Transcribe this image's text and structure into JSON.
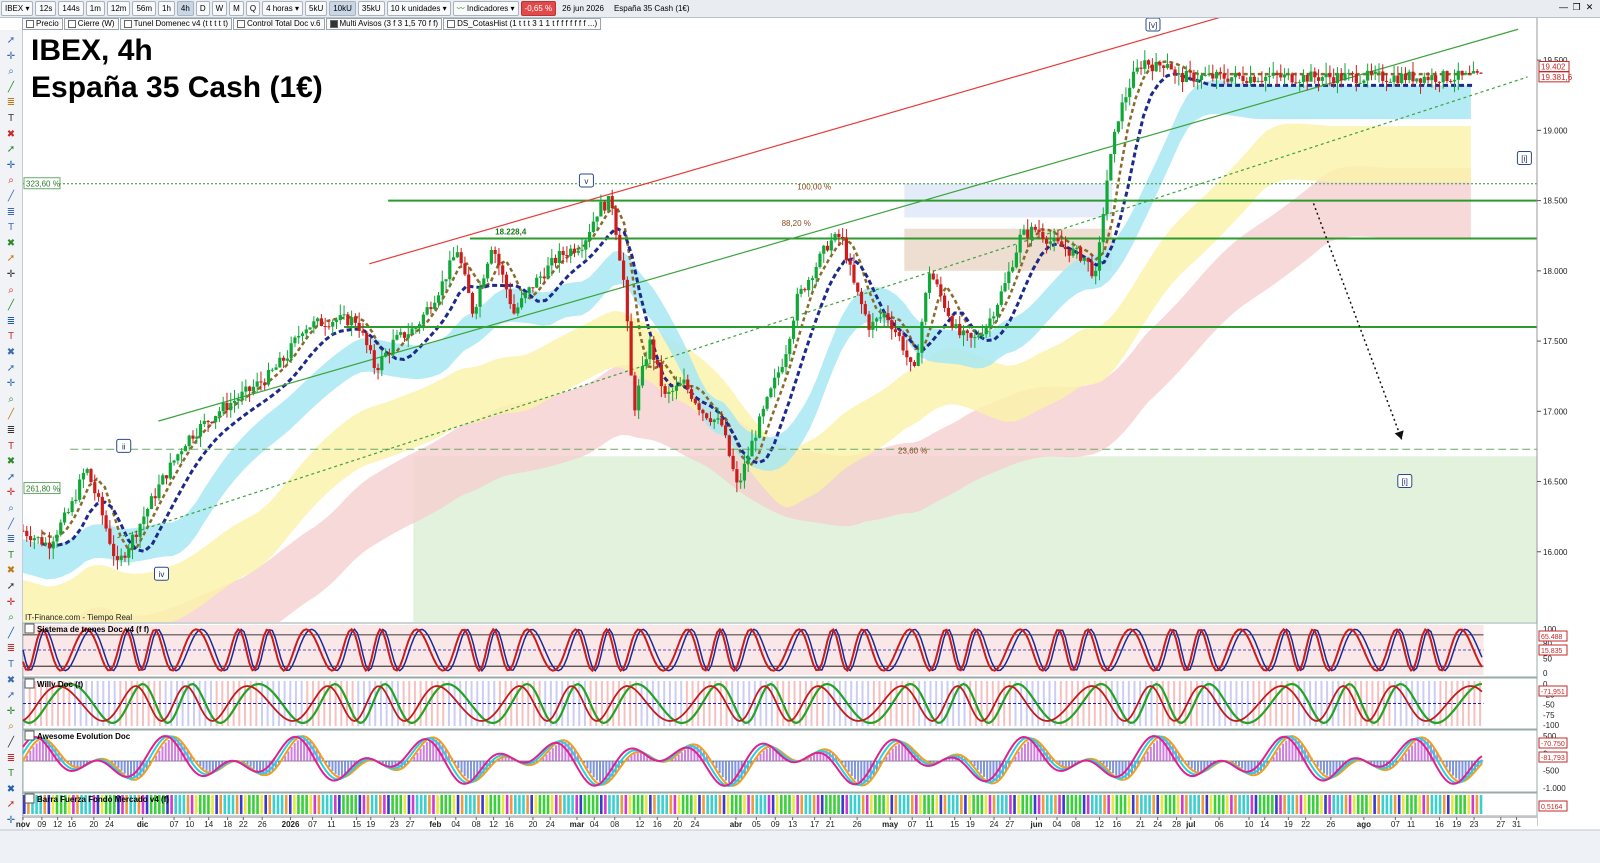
{
  "toolbar": {
    "symbol": "IBEX",
    "intervals": [
      "12s",
      "144s",
      "1m",
      "12m",
      "56m",
      "1h",
      "4h",
      "D",
      "W",
      "M",
      "Q"
    ],
    "active_interval": "4h",
    "period_label": "4 horas",
    "volume_buttons": [
      "5kU",
      "10kU",
      "35kU"
    ],
    "units_label": "10 k unidades",
    "indicators_label": "Indicadores",
    "change": "-0,65 %",
    "date": "26 jun 2026",
    "instrument": "España 35 Cash (1€)"
  },
  "ribbon": [
    {
      "label": "Precio",
      "checked": false
    },
    {
      "label": "Cierre (W)",
      "checked": false
    },
    {
      "label": "Tunel Domenec v4 (t t t t t)",
      "checked": false
    },
    {
      "label": "Control Total Doc v.6",
      "checked": false
    },
    {
      "label": "Multi Avisos (3 f 3 1,5 70 f f)",
      "checked": true
    },
    {
      "label": "DS_CotasHist (1 t t t 3 1 1 t f f f f f f f ...)",
      "checked": false
    }
  ],
  "title": {
    "line1": "IBEX, 4h",
    "line2": "España 35 Cash (1€)"
  },
  "source_label": "IT-Finance.com - Tiempo Real",
  "icons": [
    "pointer-icon",
    "crosshair-icon",
    "zoom-icon",
    "line-tool-icon",
    "fibonacci-icon",
    "text-tool-icon",
    "trash-icon"
  ],
  "colors": {
    "candle_up": "#11a83a",
    "candle_down": "#cc1c1c",
    "red_channel": "#e83a3a",
    "green_channel": "#3ca33c",
    "horizontal_levels": "#2c9a2c",
    "ma_fast": "#1d2a8a",
    "ma_slow": "#8a6a2a",
    "band_cyan": "#a8e8f2",
    "band_yellow": "#fbf3a8",
    "band_red": "#f6cccc",
    "zone_green": "#dff1d9",
    "price_tag": "#c62828"
  },
  "chart_data": {
    "type": "candlestick",
    "instrument": "IBEX",
    "timeframe": "4h",
    "y_axis": {
      "min": 15500,
      "max": 19800,
      "ticks": [
        16000,
        16500,
        17000,
        17500,
        18000,
        18500,
        19000,
        19500
      ],
      "tick_labels": [
        "16.000",
        "16.500",
        "17.000",
        "17.500",
        "18.000",
        "18.500",
        "19.000",
        "19.500"
      ]
    },
    "x_axis": {
      "labels": [
        {
          "t": 0,
          "label": "nov"
        },
        {
          "t": 0.6,
          "label": "09"
        },
        {
          "t": 1.1,
          "label": "12"
        },
        {
          "t": 1.55,
          "label": "16"
        },
        {
          "t": 2.25,
          "label": "20"
        },
        {
          "t": 2.75,
          "label": "24"
        },
        {
          "t": 3.8,
          "label": "dic"
        },
        {
          "t": 4.8,
          "label": "07"
        },
        {
          "t": 5.3,
          "label": "10"
        },
        {
          "t": 5.9,
          "label": "14"
        },
        {
          "t": 6.5,
          "label": "18"
        },
        {
          "t": 7.0,
          "label": "22"
        },
        {
          "t": 7.6,
          "label": "26"
        },
        {
          "t": 8.5,
          "label": "2026"
        },
        {
          "t": 9.2,
          "label": "07"
        },
        {
          "t": 9.8,
          "label": "11"
        },
        {
          "t": 10.6,
          "label": "15"
        },
        {
          "t": 11.05,
          "label": "19"
        },
        {
          "t": 11.8,
          "label": "23"
        },
        {
          "t": 12.3,
          "label": "27"
        },
        {
          "t": 13.1,
          "label": "feb"
        },
        {
          "t": 13.75,
          "label": "04"
        },
        {
          "t": 14.4,
          "label": "08"
        },
        {
          "t": 14.95,
          "label": "12"
        },
        {
          "t": 15.45,
          "label": "16"
        },
        {
          "t": 16.2,
          "label": "20"
        },
        {
          "t": 16.75,
          "label": "24"
        },
        {
          "t": 17.6,
          "label": "mar"
        },
        {
          "t": 18.15,
          "label": "04"
        },
        {
          "t": 18.8,
          "label": "08"
        },
        {
          "t": 19.6,
          "label": "12"
        },
        {
          "t": 20.15,
          "label": "16"
        },
        {
          "t": 20.8,
          "label": "20"
        },
        {
          "t": 21.35,
          "label": "24"
        },
        {
          "t": 22.65,
          "label": "abr"
        },
        {
          "t": 23.3,
          "label": "05"
        },
        {
          "t": 23.9,
          "label": "09"
        },
        {
          "t": 24.45,
          "label": "13"
        },
        {
          "t": 25.15,
          "label": "17"
        },
        {
          "t": 25.65,
          "label": "21"
        },
        {
          "t": 26.5,
          "label": "26"
        },
        {
          "t": 27.55,
          "label": "may"
        },
        {
          "t": 28.25,
          "label": "07"
        },
        {
          "t": 28.8,
          "label": "11"
        },
        {
          "t": 29.6,
          "label": "15"
        },
        {
          "t": 30.1,
          "label": "19"
        },
        {
          "t": 30.85,
          "label": "24"
        },
        {
          "t": 31.35,
          "label": "27"
        },
        {
          "t": 32.2,
          "label": "jun"
        },
        {
          "t": 32.85,
          "label": "04"
        },
        {
          "t": 33.45,
          "label": "08"
        },
        {
          "t": 34.2,
          "label": "12"
        },
        {
          "t": 34.75,
          "label": "16"
        },
        {
          "t": 35.5,
          "label": "21"
        },
        {
          "t": 36.05,
          "label": "24"
        },
        {
          "t": 36.65,
          "label": "28"
        },
        {
          "t": 37.1,
          "label": "jul"
        },
        {
          "t": 38.0,
          "label": "06"
        },
        {
          "t": 38.95,
          "label": "10"
        },
        {
          "t": 39.45,
          "label": "14"
        },
        {
          "t": 40.2,
          "label": "19"
        },
        {
          "t": 40.75,
          "label": "22"
        },
        {
          "t": 41.55,
          "label": "26"
        },
        {
          "t": 42.6,
          "label": "ago"
        },
        {
          "t": 43.6,
          "label": "07"
        },
        {
          "t": 44.1,
          "label": "11"
        },
        {
          "t": 45.0,
          "label": "16"
        },
        {
          "t": 45.55,
          "label": "19"
        },
        {
          "t": 46.1,
          "label": "23"
        },
        {
          "t": 46.95,
          "label": "27"
        },
        {
          "t": 47.45,
          "label": "31"
        }
      ],
      "t_max": 48.1
    },
    "price_path": [
      {
        "t": 0,
        "v": 16150
      },
      {
        "t": 0.8,
        "v": 16050
      },
      {
        "t": 1.5,
        "v": 16300
      },
      {
        "t": 2.0,
        "v": 16600
      },
      {
        "t": 2.4,
        "v": 16350
      },
      {
        "t": 3.0,
        "v": 15900
      },
      {
        "t": 3.6,
        "v": 16150
      },
      {
        "t": 4.4,
        "v": 16500
      },
      {
        "t": 5.2,
        "v": 16800
      },
      {
        "t": 6.2,
        "v": 17000
      },
      {
        "t": 7.2,
        "v": 17150
      },
      {
        "t": 7.8,
        "v": 17250
      },
      {
        "t": 8.4,
        "v": 17400
      },
      {
        "t": 8.9,
        "v": 17600
      },
      {
        "t": 9.8,
        "v": 17650
      },
      {
        "t": 10.6,
        "v": 17650
      },
      {
        "t": 11.2,
        "v": 17300
      },
      {
        "t": 11.8,
        "v": 17500
      },
      {
        "t": 12.5,
        "v": 17600
      },
      {
        "t": 13.3,
        "v": 17900
      },
      {
        "t": 13.8,
        "v": 18150
      },
      {
        "t": 14.3,
        "v": 17700
      },
      {
        "t": 14.9,
        "v": 18200
      },
      {
        "t": 15.6,
        "v": 17700
      },
      {
        "t": 16.2,
        "v": 17900
      },
      {
        "t": 17.0,
        "v": 18100
      },
      {
        "t": 17.8,
        "v": 18200
      },
      {
        "t": 18.3,
        "v": 18450
      },
      {
        "t": 18.7,
        "v": 18500
      },
      {
        "t": 19.1,
        "v": 17900
      },
      {
        "t": 19.4,
        "v": 17000
      },
      {
        "t": 19.9,
        "v": 17500
      },
      {
        "t": 20.4,
        "v": 17100
      },
      {
        "t": 21.0,
        "v": 17200
      },
      {
        "t": 21.6,
        "v": 17000
      },
      {
        "t": 22.2,
        "v": 16900
      },
      {
        "t": 22.7,
        "v": 16450
      },
      {
        "t": 23.2,
        "v": 16800
      },
      {
        "t": 23.7,
        "v": 17100
      },
      {
        "t": 24.2,
        "v": 17400
      },
      {
        "t": 24.6,
        "v": 17800
      },
      {
        "t": 25.1,
        "v": 18000
      },
      {
        "t": 25.6,
        "v": 18200
      },
      {
        "t": 26.0,
        "v": 18250
      },
      {
        "t": 26.4,
        "v": 17900
      },
      {
        "t": 26.9,
        "v": 17600
      },
      {
        "t": 27.4,
        "v": 17700
      },
      {
        "t": 27.9,
        "v": 17500
      },
      {
        "t": 28.3,
        "v": 17250
      },
      {
        "t": 28.8,
        "v": 18000
      },
      {
        "t": 29.2,
        "v": 17800
      },
      {
        "t": 29.7,
        "v": 17550
      },
      {
        "t": 30.2,
        "v": 17500
      },
      {
        "t": 30.7,
        "v": 17650
      },
      {
        "t": 31.2,
        "v": 17900
      },
      {
        "t": 31.7,
        "v": 18250
      },
      {
        "t": 32.2,
        "v": 18300
      },
      {
        "t": 32.7,
        "v": 18200
      },
      {
        "t": 33.2,
        "v": 18150
      },
      {
        "t": 33.7,
        "v": 18100
      },
      {
        "t": 34.1,
        "v": 17950
      },
      {
        "t": 34.4,
        "v": 18600
      },
      {
        "t": 34.8,
        "v": 19100
      },
      {
        "t": 35.2,
        "v": 19350
      },
      {
        "t": 35.6,
        "v": 19500
      },
      {
        "t": 36.0,
        "v": 19450
      },
      {
        "t": 36.4,
        "v": 19500
      },
      {
        "t": 36.6,
        "v": 19380
      }
    ],
    "levels": [
      {
        "name": "level-18500",
        "value": 18500,
        "t_start": 11.6,
        "style": "solid"
      },
      {
        "name": "level-18230",
        "value": 18230,
        "t_start": 14.2,
        "style": "solid"
      },
      {
        "name": "level-17600",
        "value": 17600,
        "t_start": 10.2,
        "style": "solid"
      },
      {
        "name": "level-18620",
        "value": 18620,
        "t_start": 0,
        "style": "dotted"
      },
      {
        "name": "level-16730",
        "value": 16730,
        "t_start": 1.5,
        "style": "dashed"
      }
    ],
    "channels": [
      {
        "name": "red-upper-channel",
        "color": "red",
        "from": {
          "t": 11.0,
          "v": 18050
        },
        "to": {
          "t": 39.5,
          "v": 19900
        }
      },
      {
        "name": "green-channel",
        "color": "green",
        "from": {
          "t": 4.3,
          "v": 16930
        },
        "to": {
          "t": 47.5,
          "v": 19720
        }
      },
      {
        "name": "green-dotted-channel",
        "color": "green_dotted",
        "from": {
          "t": 3.0,
          "v": 16100
        },
        "to": {
          "t": 47.8,
          "v": 19380
        }
      }
    ],
    "projection_arrow": {
      "from": {
        "t": 41.0,
        "v": 18480
      },
      "to": {
        "t": 43.8,
        "v": 16800
      }
    },
    "annotations": [
      {
        "text": "18.228,4",
        "t": 15.0,
        "v": 18260
      },
      {
        "text": "88,20 %",
        "t": 24.1,
        "v": 18320
      },
      {
        "text": "100,00 %",
        "t": 24.6,
        "v": 18580
      },
      {
        "text": "23,60 %",
        "t": 27.8,
        "v": 16700
      },
      {
        "text": "323,60 %",
        "t": 0,
        "v": 18620,
        "box": true
      },
      {
        "text": "261,80 %",
        "t": 0,
        "v": 16450,
        "box": true
      }
    ],
    "wave_labels": [
      {
        "text": "[v]",
        "t": 35.9,
        "v": 19750
      },
      {
        "text": "v",
        "t": 17.9,
        "v": 18640
      },
      {
        "text": "ii",
        "t": 3.2,
        "v": 16750
      },
      {
        "text": "iv",
        "t": 4.4,
        "v": 15840
      },
      {
        "text": "[i]",
        "t": 43.9,
        "v": 16500
      },
      {
        "text": "[i]",
        "t": 47.7,
        "v": 18800
      }
    ],
    "price_tags": [
      {
        "text": "19.381,6",
        "v": 19381,
        "color": "price_tag"
      },
      {
        "text": "19.402",
        "v": 19455,
        "color": "price_tag"
      }
    ],
    "indicators": [
      {
        "name": "Sistema de trenes Doc v4 (f f)",
        "ticks": [
          "100",
          "80",
          "50",
          "0"
        ],
        "tags": [
          "65.488",
          "15.835"
        ]
      },
      {
        "name": "Willy Doc (t)",
        "ticks": [
          "0",
          "-25",
          "-50",
          "-75",
          "-100"
        ],
        "tags": [
          "-71,951"
        ]
      },
      {
        "name": "Awesome Evolution Doc",
        "ticks": [
          "500",
          "0",
          "-500",
          "-1.000"
        ],
        "tags": [
          "-70.750",
          "-81,793"
        ]
      },
      {
        "name": "Barra Fuerza Fondo Mercado v4 (f)",
        "ticks": [],
        "tags": [
          "0,5164"
        ]
      }
    ]
  }
}
